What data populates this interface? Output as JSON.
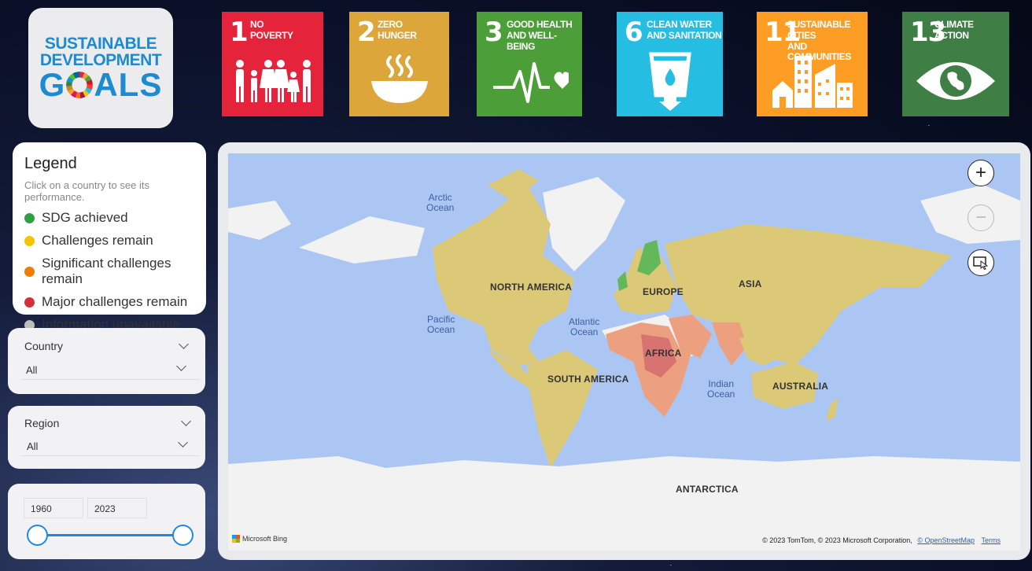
{
  "logo": {
    "line1": "SUSTAINABLE",
    "line2": "DEVELOPMENT",
    "line3a": "G",
    "line3b": "ALS"
  },
  "goals": [
    {
      "number": "1",
      "title_l1": "NO",
      "title_l2": "POVERTY",
      "color": "#e5243b",
      "icon": "family-icon"
    },
    {
      "number": "2",
      "title_l1": "ZERO",
      "title_l2": "HUNGER",
      "color": "#dda63a",
      "icon": "bowl-icon"
    },
    {
      "number": "3",
      "title_l1": "GOOD HEALTH",
      "title_l2": "AND WELL-BEING",
      "color": "#4c9f38",
      "icon": "heartbeat-icon"
    },
    {
      "number": "6",
      "title_l1": "CLEAN WATER",
      "title_l2": "AND SANITATION",
      "color": "#26bde2",
      "icon": "water-glass-icon"
    },
    {
      "number": "11",
      "title_l1": "SUSTAINABLE CITIES",
      "title_l2": "AND COMMUNITIES",
      "color": "#fd9d24",
      "icon": "city-icon"
    },
    {
      "number": "13",
      "title_l1": "CLIMATE",
      "title_l2": "ACTION",
      "color": "#3f7e44",
      "icon": "earth-eye-icon"
    }
  ],
  "legend": {
    "title": "Legend",
    "subtitle": "Click on a country to see its performance.",
    "items": [
      {
        "label": "SDG achieved",
        "color": "#2ea043"
      },
      {
        "label": "Challenges remain",
        "color": "#f5c400"
      },
      {
        "label": "Significant challenges remain",
        "color": "#f07d00"
      },
      {
        "label": "Major challenges remain",
        "color": "#d62f3a"
      },
      {
        "label": "Information unavailable",
        "color": "#bdbdbd"
      }
    ]
  },
  "country_slicer": {
    "label": "Country",
    "value": "All"
  },
  "region_slicer": {
    "label": "Region",
    "value": "All"
  },
  "year_slicer": {
    "start": "1960",
    "end": "2023"
  },
  "map": {
    "labels": {
      "north_america": "NORTH AMERICA",
      "south_america": "SOUTH AMERICA",
      "europe": "EUROPE",
      "asia": "ASIA",
      "africa": "AFRICA",
      "australia": "AUSTRALIA",
      "antarctica": "ANTARCTICA"
    },
    "oceans": {
      "arctic_l1": "Arctic",
      "arctic_l2": "Ocean",
      "pacific_l1": "Pacific",
      "pacific_l2": "Ocean",
      "atlantic_l1": "Atlantic",
      "atlantic_l2": "Ocean",
      "indian_l1": "Indian",
      "indian_l2": "Ocean"
    },
    "zoom_in": "+",
    "zoom_out": "−",
    "attribution": "Microsoft Bing",
    "copyright": "© 2023 TomTom, © 2023 Microsoft Corporation,",
    "osm_link": "© OpenStreetMap",
    "terms_link": "Terms",
    "colors": {
      "ocean": "#abc6f2",
      "challenges": "#dcc977",
      "achieved": "#62b85b",
      "significant": "#eda07f",
      "major": "#d77370",
      "unavailable": "#f2f2f2"
    }
  }
}
